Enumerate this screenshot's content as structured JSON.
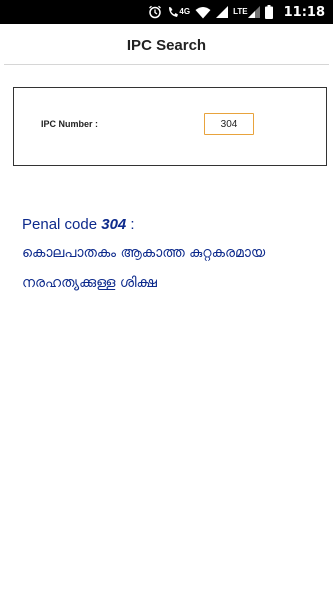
{
  "status_bar": {
    "network_label": "4G",
    "lte_label": "LTE",
    "time": "11:18",
    "icons": [
      "alarm-icon",
      "call-signal-icon",
      "wifi-icon",
      "signal-icon",
      "lte-signal-icon",
      "battery-icon"
    ]
  },
  "header": {
    "title": "IPC Search"
  },
  "search": {
    "label": "IPC Number :",
    "value": "304"
  },
  "result": {
    "prefix": "Penal code ",
    "code": "304",
    "suffix": " :",
    "description_line1": "കൊലപാതകം ആകാത്ത കുറ്റകരമായ",
    "description_line2": "നരഹത്യക്കുള്ള ശിക്ഷ"
  },
  "colors": {
    "status_bar_bg": "#000000",
    "input_border": "#e8a33d",
    "result_text": "#0d2a8c"
  }
}
